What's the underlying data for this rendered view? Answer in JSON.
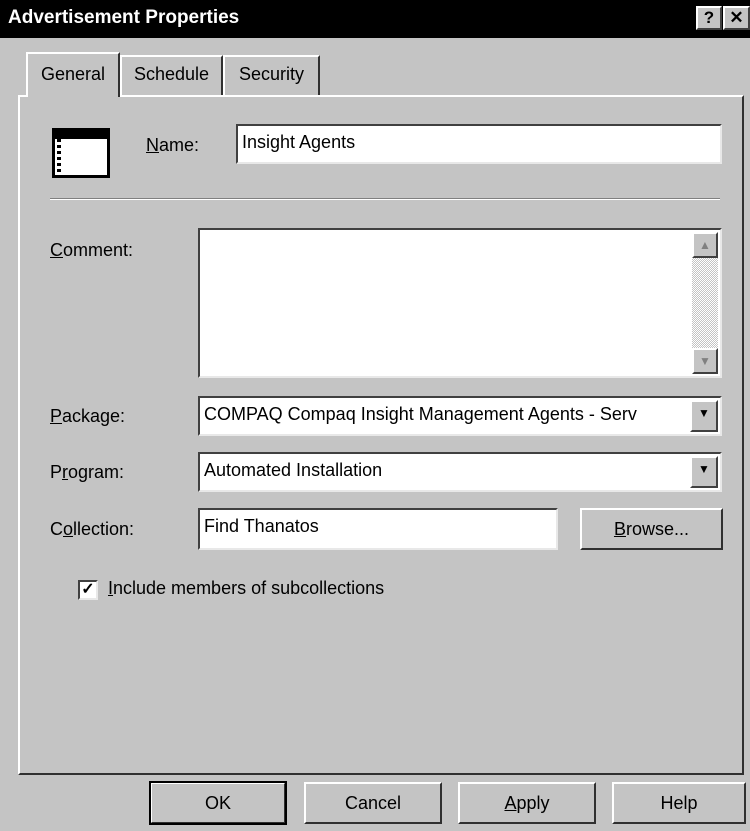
{
  "window": {
    "title": "Advertisement Properties",
    "help_glyph": "?",
    "close_glyph": "✕"
  },
  "tabs": [
    {
      "label": "General",
      "selected": true
    },
    {
      "label": "Schedule",
      "selected": false
    },
    {
      "label": "Security",
      "selected": false
    }
  ],
  "form": {
    "name": {
      "label_mnemonic": "N",
      "label_rest": "ame:",
      "value": "Insight Agents"
    },
    "comment": {
      "label_mnemonic": "C",
      "label_rest": "omment:",
      "value": ""
    },
    "package": {
      "label_mnemonic": "P",
      "label_rest": "ackage:",
      "value": "COMPAQ Compaq Insight Management Agents - Serv"
    },
    "program": {
      "label_prefix": "P",
      "label_mnemonic": "r",
      "label_rest": "ogram:",
      "value": "Automated Installation"
    },
    "collection": {
      "label_prefix": "C",
      "label_mnemonic": "o",
      "label_rest": "llection:",
      "value": "Find Thanatos"
    },
    "browse": {
      "mnemonic": "B",
      "rest": "rowse..."
    },
    "include_subcollections": {
      "mnemonic": "I",
      "rest": "nclude members of subcollections",
      "checked": true
    }
  },
  "buttons": {
    "ok": "OK",
    "cancel": "Cancel",
    "apply_mnemonic": "A",
    "apply_rest": "pply",
    "help": "Help"
  },
  "icons": {
    "app": "application-window-icon",
    "scroll_up": "scroll-up-arrow-icon",
    "scroll_down": "scroll-down-arrow-icon",
    "dropdown": "chevron-down-icon",
    "check": "checkmark-icon"
  }
}
